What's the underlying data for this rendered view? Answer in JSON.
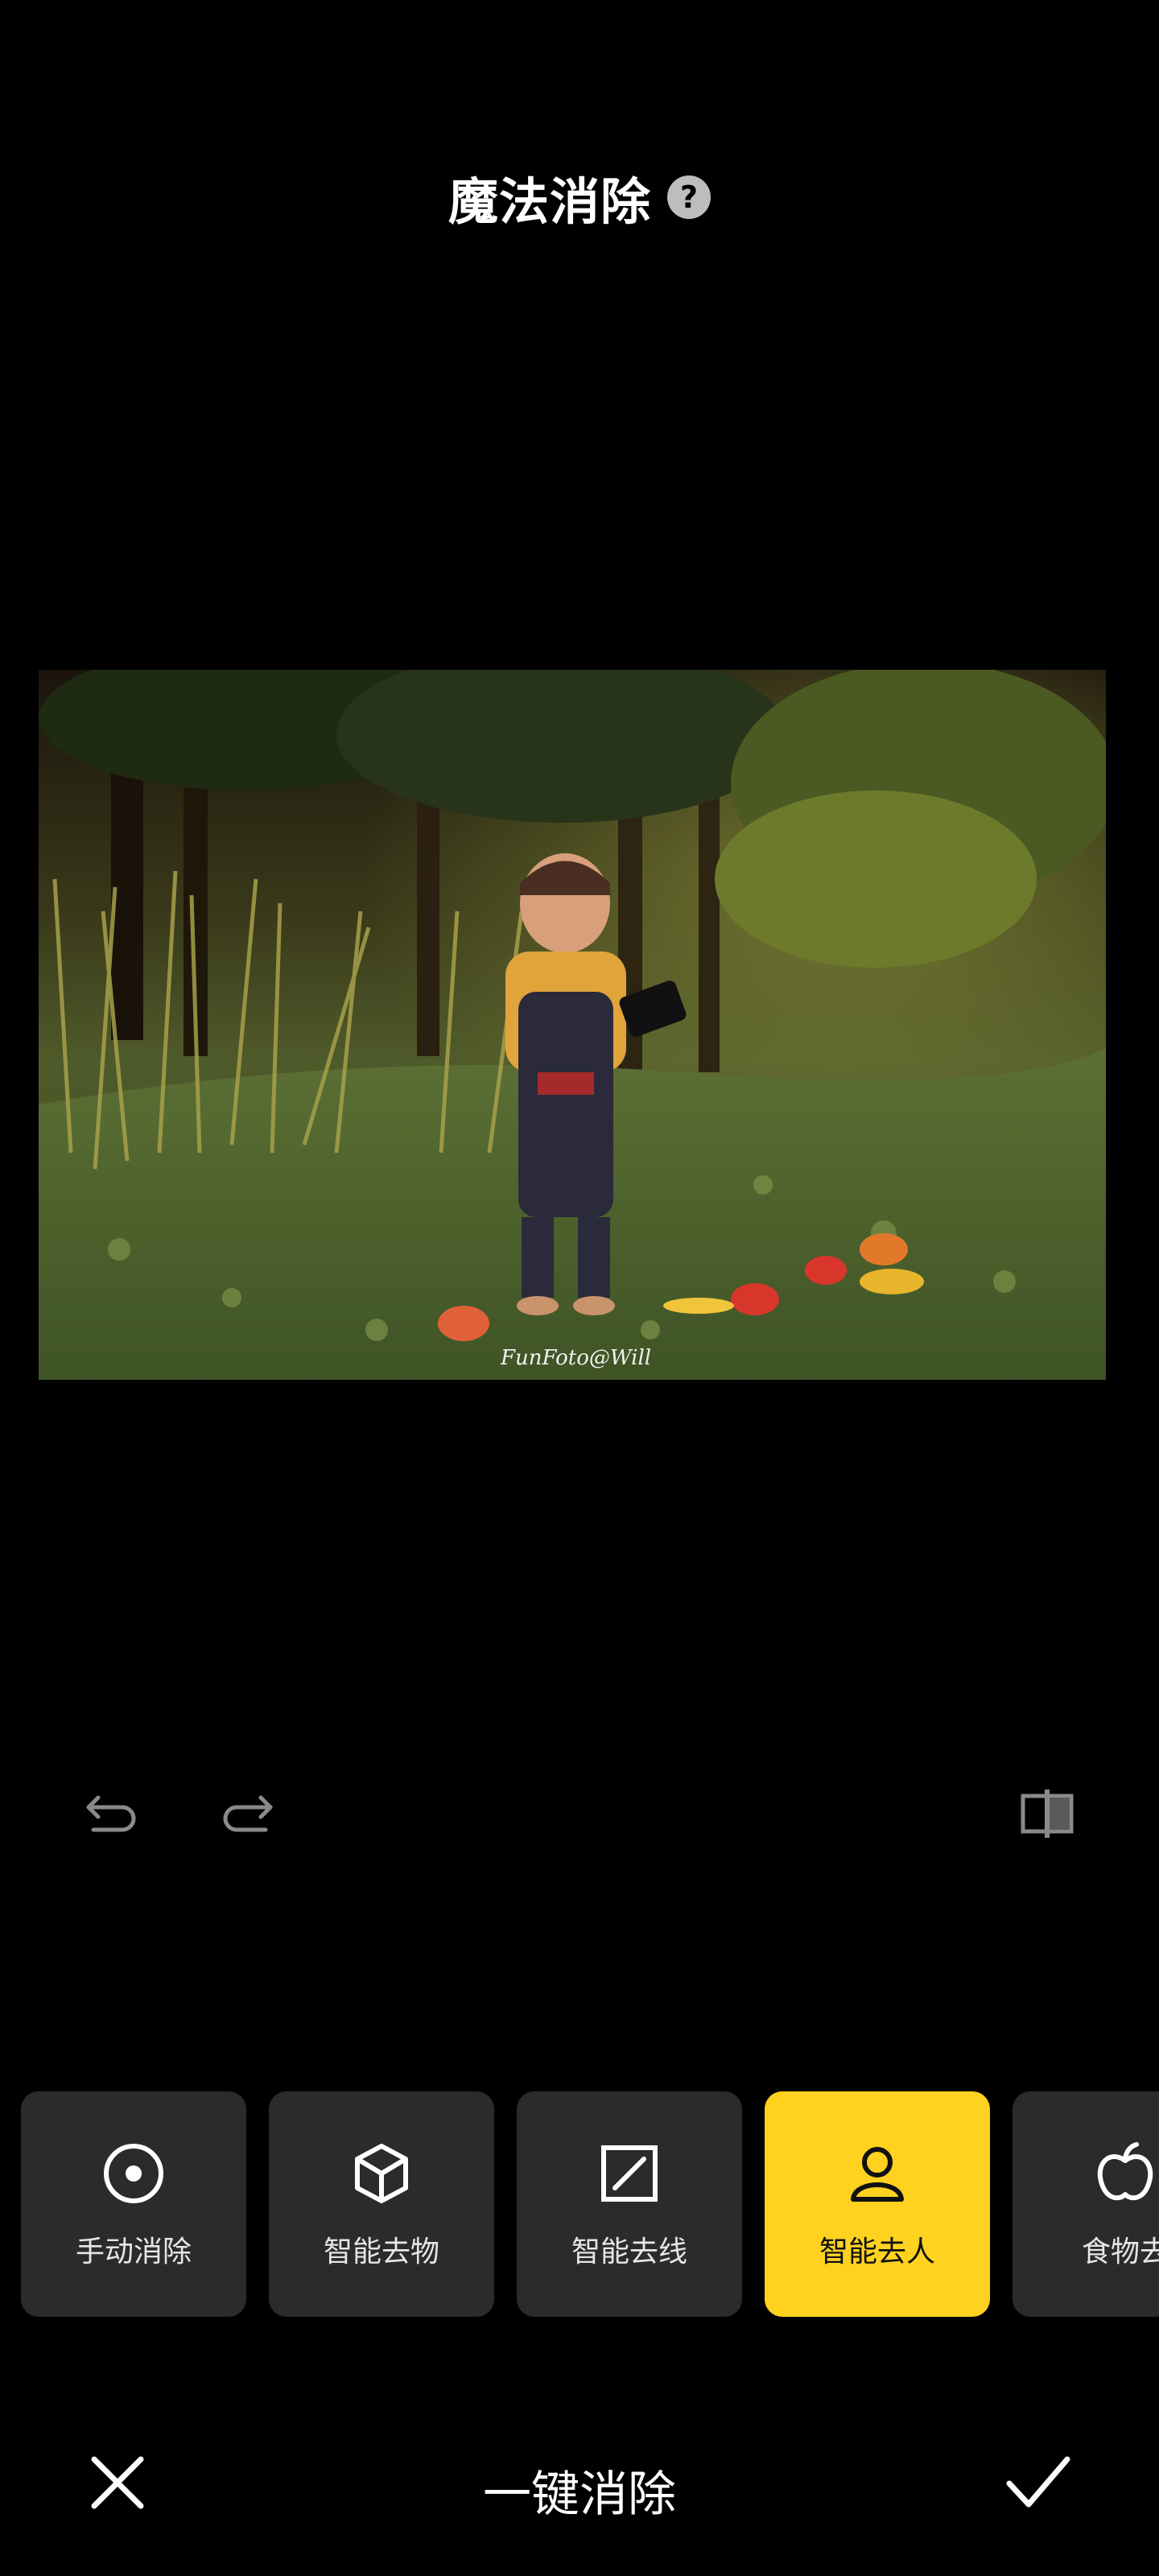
{
  "header": {
    "title": "魔法消除",
    "help_glyph": "?"
  },
  "photo": {
    "watermark": "FunFoto@Will",
    "description_icon": "photo-image"
  },
  "toolbar": {
    "undo_icon": "undo-icon",
    "redo_icon": "redo-icon",
    "compare_icon": "compare-icon"
  },
  "tools": [
    {
      "label": "手动消除",
      "icon": "target-icon",
      "active": false
    },
    {
      "label": "智能去物",
      "icon": "cube-icon",
      "active": false
    },
    {
      "label": "智能去线",
      "icon": "slash-square-icon",
      "active": false
    },
    {
      "label": "智能去人",
      "icon": "person-icon",
      "active": true
    },
    {
      "label": "食物去",
      "icon": "apple-icon",
      "active": false
    }
  ],
  "bottom": {
    "action_label": "一键消除",
    "cancel_icon": "close-icon",
    "confirm_icon": "check-icon"
  },
  "colors": {
    "accent": "#ffd21f",
    "tile": "#2b2b2b",
    "background": "#000000"
  }
}
